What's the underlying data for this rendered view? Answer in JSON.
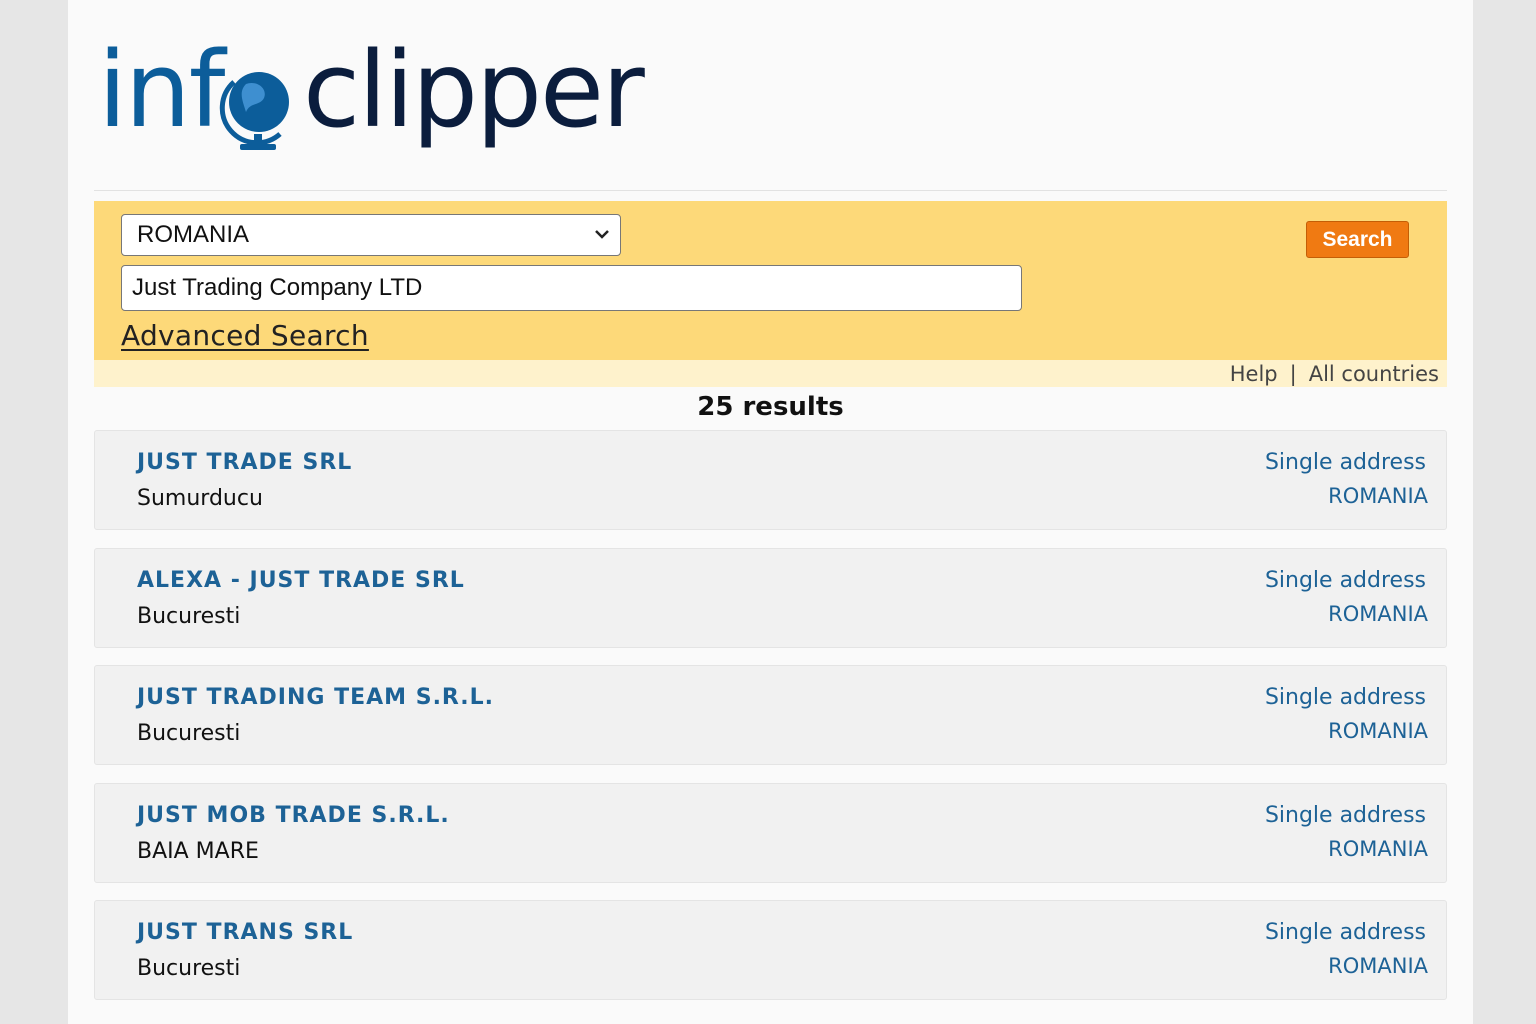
{
  "logo": {
    "part1": "inf",
    "part2": "clipper"
  },
  "search": {
    "country": "ROMANIA",
    "query": "Just Trading Company LTD",
    "advanced_label": "Advanced Search",
    "button_label": "Search"
  },
  "links": {
    "help": "Help",
    "separator": "|",
    "all_countries": "All countries"
  },
  "results_count": "25 results",
  "results": [
    {
      "name": "JUST TRADE SRL",
      "city": "Sumurducu",
      "type": "Single address",
      "country": "ROMANIA"
    },
    {
      "name": "ALEXA - JUST TRADE SRL",
      "city": "Bucuresti",
      "type": "Single address",
      "country": "ROMANIA"
    },
    {
      "name": "JUST TRADING TEAM S.R.L.",
      "city": "Bucuresti",
      "type": "Single address",
      "country": "ROMANIA"
    },
    {
      "name": "JUST MOB TRADE S.R.L.",
      "city": "BAIA MARE",
      "type": "Single address",
      "country": "ROMANIA"
    },
    {
      "name": "JUST TRANS SRL",
      "city": "Bucuresti",
      "type": "Single address",
      "country": "ROMANIA"
    }
  ],
  "colors": {
    "accent": "#f07a12",
    "panel": "#fdd979",
    "link": "#1d6296"
  }
}
